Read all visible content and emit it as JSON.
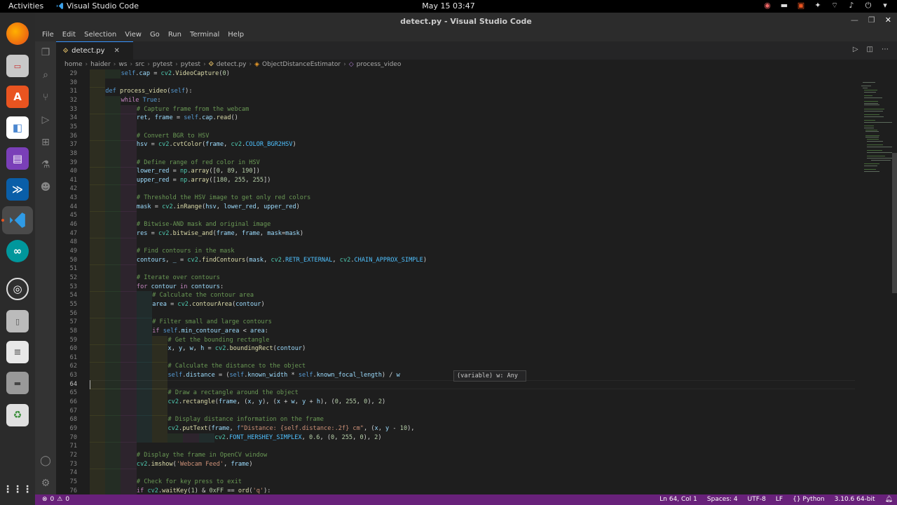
{
  "topbar": {
    "activities": "Activities",
    "app_name": "Visual Studio Code",
    "clock": "May 15  03:47",
    "tray_icons": [
      "record-icon",
      "screen-icon",
      "media-icon",
      "accessibility-icon",
      "network-icon",
      "volume-icon",
      "power-icon",
      "chevron-down-icon"
    ]
  },
  "dock": {
    "items": [
      "firefox-icon",
      "files-icon",
      "software-center-icon",
      "flathub-icon",
      "text-editor-icon",
      "powershell-icon",
      "vscode-icon",
      "arduino-icon",
      "obs-icon",
      "usb-drive-icon",
      "document-icon",
      "drive-icon",
      "trash-icon",
      "show-apps-icon"
    ]
  },
  "window": {
    "title": "detect.py - Visual Studio Code",
    "menu": [
      "File",
      "Edit",
      "Selection",
      "View",
      "Go",
      "Run",
      "Terminal",
      "Help"
    ],
    "tab_label": "detect.py",
    "breadcrumb": [
      "home",
      "haider",
      "ws",
      "src",
      "pytest",
      "pytest",
      "detect.py",
      "ObjectDistanceEstimator",
      "process_video"
    ]
  },
  "code_lines": [
    {
      "n": "29",
      "indent": 2,
      "text": "self.cap = cv2.VideoCapture(0)"
    },
    {
      "n": "30",
      "indent": 0,
      "text": ""
    },
    {
      "n": "31",
      "indent": 1,
      "text": "def process_video(self):"
    },
    {
      "n": "32",
      "indent": 2,
      "text": "while True:"
    },
    {
      "n": "33",
      "indent": 3,
      "text": "# Capture frame from the webcam"
    },
    {
      "n": "34",
      "indent": 3,
      "text": "ret, frame = self.cap.read()"
    },
    {
      "n": "35",
      "indent": 0,
      "text": ""
    },
    {
      "n": "36",
      "indent": 3,
      "text": "# Convert BGR to HSV"
    },
    {
      "n": "37",
      "indent": 3,
      "text": "hsv = cv2.cvtColor(frame, cv2.COLOR_BGR2HSV)"
    },
    {
      "n": "38",
      "indent": 0,
      "text": ""
    },
    {
      "n": "39",
      "indent": 3,
      "text": "# Define range of red color in HSV"
    },
    {
      "n": "40",
      "indent": 3,
      "text": "lower_red = np.array([0, 89, 190])"
    },
    {
      "n": "41",
      "indent": 3,
      "text": "upper_red = np.array([180, 255, 255])"
    },
    {
      "n": "42",
      "indent": 0,
      "text": ""
    },
    {
      "n": "43",
      "indent": 3,
      "text": "# Threshold the HSV image to get only red colors"
    },
    {
      "n": "44",
      "indent": 3,
      "text": "mask = cv2.inRange(hsv, lower_red, upper_red)"
    },
    {
      "n": "45",
      "indent": 0,
      "text": ""
    },
    {
      "n": "46",
      "indent": 3,
      "text": "# Bitwise-AND mask and original image"
    },
    {
      "n": "47",
      "indent": 3,
      "text": "res = cv2.bitwise_and(frame, frame, mask=mask)"
    },
    {
      "n": "48",
      "indent": 0,
      "text": ""
    },
    {
      "n": "49",
      "indent": 3,
      "text": "# Find contours in the mask"
    },
    {
      "n": "50",
      "indent": 3,
      "text": "contours, _ = cv2.findContours(mask, cv2.RETR_EXTERNAL, cv2.CHAIN_APPROX_SIMPLE)"
    },
    {
      "n": "51",
      "indent": 0,
      "text": ""
    },
    {
      "n": "52",
      "indent": 3,
      "text": "# Iterate over contours"
    },
    {
      "n": "53",
      "indent": 3,
      "text": "for contour in contours:"
    },
    {
      "n": "54",
      "indent": 4,
      "text": "# Calculate the contour area"
    },
    {
      "n": "55",
      "indent": 4,
      "text": "area = cv2.contourArea(contour)"
    },
    {
      "n": "56",
      "indent": 0,
      "text": ""
    },
    {
      "n": "57",
      "indent": 4,
      "text": "# Filter small and large contours"
    },
    {
      "n": "58",
      "indent": 4,
      "text": "if self.min_contour_area < area:"
    },
    {
      "n": "59",
      "indent": 5,
      "text": "# Get the bounding rectangle"
    },
    {
      "n": "60",
      "indent": 5,
      "text": "x, y, w, h = cv2.boundingRect(contour)"
    },
    {
      "n": "61",
      "indent": 0,
      "text": ""
    },
    {
      "n": "62",
      "indent": 5,
      "text": "# Calculate the distance to the object"
    },
    {
      "n": "63",
      "indent": 5,
      "text": "self.distance = (self.known_width * self.known_focal_length) / w"
    },
    {
      "n": "64",
      "indent": 0,
      "text": ""
    },
    {
      "n": "65",
      "indent": 5,
      "text": "# Draw a rectangle around the object"
    },
    {
      "n": "66",
      "indent": 5,
      "text": "cv2.rectangle(frame, (x, y), (x + w, y + h), (0, 255, 0), 2)"
    },
    {
      "n": "67",
      "indent": 0,
      "text": ""
    },
    {
      "n": "68",
      "indent": 5,
      "text": "# Display distance information on the frame"
    },
    {
      "n": "69",
      "indent": 5,
      "text": "cv2.putText(frame, f\"Distance: {self.distance:.2f} cm\", (x, y - 10),"
    },
    {
      "n": "70",
      "indent": 8,
      "text": "cv2.FONT_HERSHEY_SIMPLEX, 0.6, (0, 255, 0), 2)"
    },
    {
      "n": "71",
      "indent": 0,
      "text": ""
    },
    {
      "n": "72",
      "indent": 3,
      "text": "# Display the frame in OpenCV window"
    },
    {
      "n": "73",
      "indent": 3,
      "text": "cv2.imshow('Webcam Feed', frame)"
    },
    {
      "n": "74",
      "indent": 0,
      "text": ""
    },
    {
      "n": "75",
      "indent": 3,
      "text": "# Check for key press to exit"
    },
    {
      "n": "76",
      "indent": 3,
      "text": "if cv2.waitKey(1) & 0xFF == ord('q'):"
    }
  ],
  "current_line": "64",
  "hover_tooltip": "(variable) w: Any",
  "statusbar": {
    "errors": "0",
    "warnings": "0",
    "position": "Ln 64, Col 1",
    "spaces": "Spaces: 4",
    "encoding": "UTF-8",
    "eol": "LF",
    "language": "Python",
    "interpreter": "3.10.6 64-bit"
  },
  "colors": {
    "statusbar": "#68217a",
    "keyword": "#c586c0",
    "def": "#569cd6",
    "function": "#dcdcaa",
    "comment": "#6a9955",
    "variable": "#9cdcfe",
    "number": "#b5cea8",
    "string": "#ce9178",
    "constant": "#4fc1ff"
  }
}
